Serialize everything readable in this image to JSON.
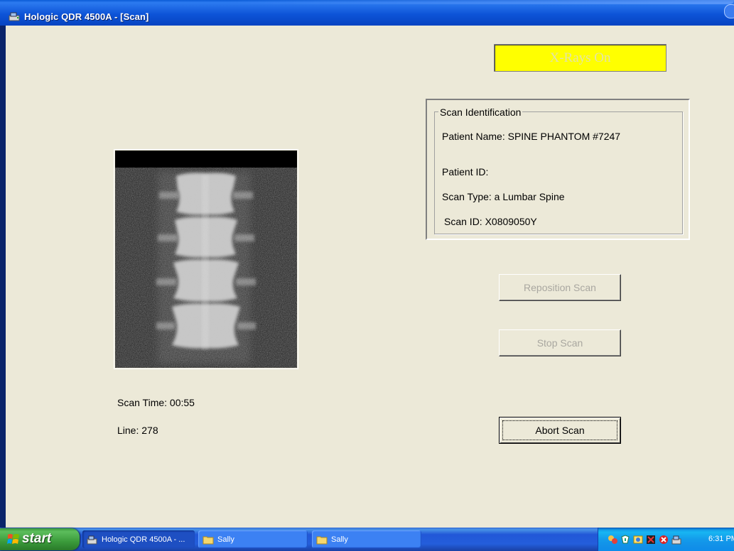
{
  "window": {
    "title": "Hologic QDR 4500A - [Scan]"
  },
  "indicator": {
    "label": "X-Rays On",
    "color": "#ffff00"
  },
  "scan_identification": {
    "legend": "Scan Identification",
    "patient_name": "Patient Name:  SPINE PHANTOM #7247",
    "patient_id": "Patient ID:",
    "scan_type": "Scan Type: a Lumbar Spine",
    "scan_id": "Scan ID: X0809050Y"
  },
  "scan_status": {
    "scan_time": "Scan Time: 00:55",
    "line": "Line: 278"
  },
  "buttons": {
    "reposition": "Reposition Scan",
    "stop": "Stop Scan",
    "abort": "Abort Scan"
  },
  "taskbar": {
    "start_label": "start",
    "tasks": [
      {
        "label": "Hologic QDR 4500A - ...",
        "icon": "app-icon",
        "active": true
      },
      {
        "label": "Sally",
        "icon": "folder-icon",
        "active": false
      },
      {
        "label": "Sally",
        "icon": "folder-icon",
        "active": false
      }
    ],
    "tray_icons": [
      "network-icon",
      "security-icon",
      "messenger-icon",
      "update-icon",
      "antivirus-icon",
      "app-tray-icon"
    ],
    "clock": "6:31 PM"
  }
}
